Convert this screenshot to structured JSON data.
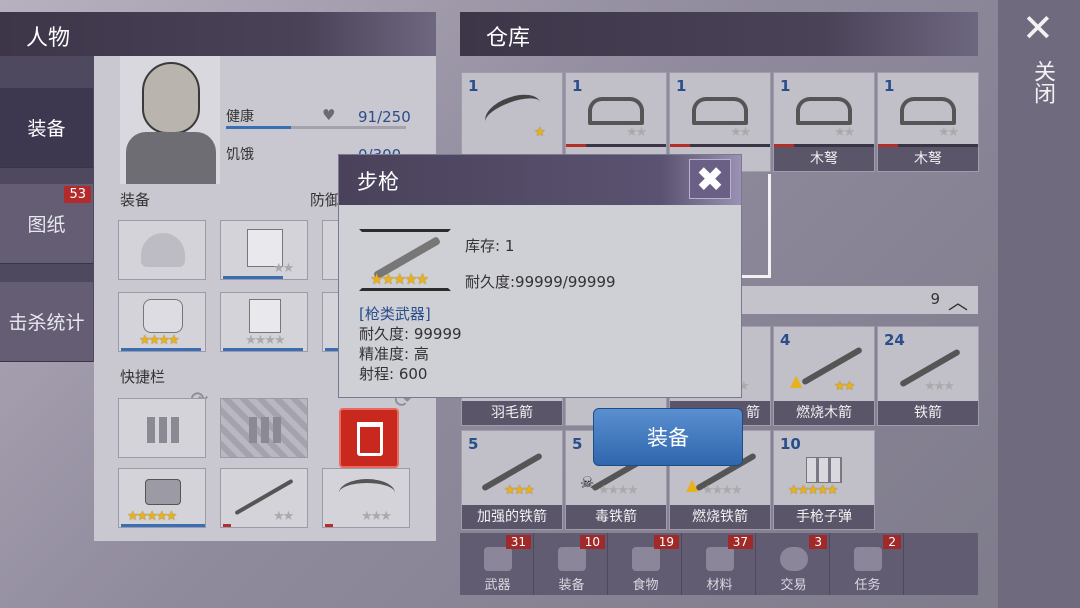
{
  "character": {
    "header": "人物",
    "health_label": "健康",
    "health_value": "91/250",
    "hunger_label": "饥饿",
    "hunger_value": "0/300"
  },
  "left_nav": [
    {
      "label": "装备",
      "active": true
    },
    {
      "label": "图纸",
      "badge": "53"
    },
    {
      "label": "击杀统计"
    }
  ],
  "sections": {
    "equipment": "装备",
    "defense": "防御",
    "hotbar": "快捷栏"
  },
  "warehouse": {
    "header": "仓库",
    "page_count": "9",
    "row1": [
      {
        "count": "1",
        "name": ""
      },
      {
        "count": "1",
        "name": ""
      },
      {
        "count": "1",
        "name": ""
      },
      {
        "count": "1",
        "name": "木弩"
      },
      {
        "count": "1",
        "name": "木弩"
      }
    ],
    "row2": [
      {
        "count": "",
        "name": "羽毛箭"
      },
      {
        "count": "",
        "name": ""
      },
      {
        "count": "",
        "name": "箭"
      },
      {
        "count": "4",
        "name": "燃烧木箭"
      },
      {
        "count": "24",
        "name": "铁箭"
      }
    ],
    "row3": [
      {
        "count": "5",
        "name": "加强的铁箭"
      },
      {
        "count": "5",
        "name": "毒铁箭"
      },
      {
        "count": "",
        "name": "燃烧铁箭"
      },
      {
        "count": "10",
        "name": "手枪子弹"
      }
    ]
  },
  "tabs": [
    {
      "label": "武器",
      "badge": "31"
    },
    {
      "label": "装备",
      "badge": "10"
    },
    {
      "label": "食物",
      "badge": "19"
    },
    {
      "label": "材料",
      "badge": "37"
    },
    {
      "label": "交易",
      "badge": "3"
    },
    {
      "label": "任务",
      "badge": "2"
    }
  ],
  "close_label": "关闭",
  "item_popup": {
    "title": "步枪",
    "stock": "库存: 1",
    "durability_summary": "耐久度:99999/99999",
    "category": "[枪类武器]",
    "durability": "耐久度: 99999",
    "accuracy": "精准度: 高",
    "range": "射程: 600",
    "equip_label": "装备"
  },
  "colors": {
    "accent_blue": "#3a6fb5",
    "star_gold": "#e8b21e",
    "danger_red": "#c8281e"
  }
}
